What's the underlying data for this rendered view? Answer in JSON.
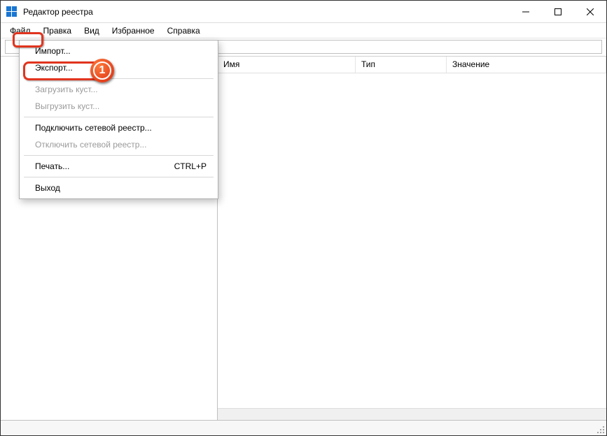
{
  "window": {
    "title": "Редактор реестра"
  },
  "menubar": {
    "items": [
      "Файл",
      "Правка",
      "Вид",
      "Избранное",
      "Справка"
    ]
  },
  "address": {
    "value": ""
  },
  "columns": {
    "name": "Имя",
    "type": "Тип",
    "value": "Значение"
  },
  "file_menu": {
    "import": "Импорт...",
    "export": "Экспорт...",
    "load_hive": "Загрузить куст...",
    "unload_hive": "Выгрузить куст...",
    "connect_net": "Подключить сетевой реестр...",
    "disconnect_net": "Отключить сетевой реестр...",
    "print": "Печать...",
    "print_shortcut": "CTRL+P",
    "exit": "Выход"
  },
  "annotation": {
    "step_number": "1"
  }
}
